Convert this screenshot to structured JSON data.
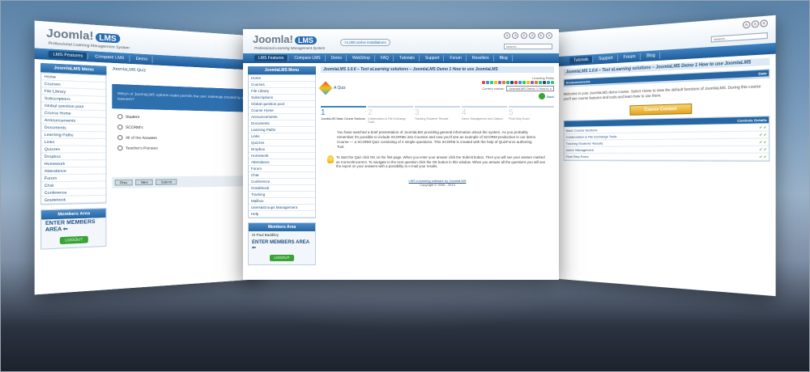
{
  "brand": {
    "logo_text": "Joomla!",
    "logo_badge": "LMS",
    "tagline": "Professional Learning Management System",
    "installs": ">1,000 active installations"
  },
  "header": {
    "tool_icons": [
      "A",
      "A",
      "A",
      "A",
      "A",
      "A"
    ],
    "search_placeholder": "search..."
  },
  "nav": [
    "LMS Features",
    "Compare LMS",
    "Demo",
    "WebShop",
    "FAQ",
    "Tutorials",
    "Support",
    "Forum",
    "Resellers",
    "Blog"
  ],
  "sidebar": {
    "title": "JoomlaLMS Menu",
    "items": [
      "Home",
      "Courses",
      "File Library",
      "Subscriptions",
      "Global question pool",
      "Course Home",
      "Announcements",
      "Documents",
      "Learning Paths",
      "Links",
      "Quizzes",
      "Dropbox",
      "Homework",
      "Attendance",
      "Forum",
      "Chat",
      "Conference",
      "Gradebook",
      "Tracking",
      "Mailbox",
      "Users&Groups Management",
      "Help"
    ]
  },
  "members": {
    "title": "Members Area",
    "greeting": "Hi Paul Baddiley",
    "enter": "ENTER MEMBERS AREA ⇐",
    "logout": "LOGOUT"
  },
  "main": {
    "title": "JoomlaLMS 1.0.6 – Test eLearning solutions – JoomlaLMS Demo 1 How to use JoomlaLMS",
    "quiz_label": "A Quiz",
    "learning_paths": "Learning Paths",
    "current_course_label": "Current course:",
    "current_course": "JoomlaLMS Demo 1 How to u",
    "back": "Back",
    "steps": [
      {
        "num": "1",
        "label": "JoomlaLMS Basic Course Sections"
      },
      {
        "num": "2",
        "label": "Collaboration & File Exchange Tools"
      },
      {
        "num": "3",
        "label": "Tracking Students' Results"
      },
      {
        "num": "4",
        "label": "Users' Management and Options"
      },
      {
        "num": "5",
        "label": "Final Step Exam"
      }
    ],
    "paragraph": "You have watched a brief presentation of JoomlaLMS providing general information about the system. As you probably remember it's possible to include SCORMs into Courses and now you'll see an example of SCORM production in our demo Course — a SCORM Quiz consisting of 4 simple questions. This SCORM is created with the help of QuizForce authoring Tool.",
    "hint": "To start the Quiz click OK on the first page. When you enter your answer click the Submit button. Then you will see your answer marked as Correct/Incorrect. To navigate to the next question click the OK button in this window. When you answer all the questions you will see the report on your answers with a possibility to e-mail your results.",
    "footer_link": "LMS e-learning software by JoomlaLMS",
    "footer_copy": "Copyright © 2006 - 2013"
  },
  "left_shot": {
    "quiz_title": "JoomlaLMS Quiz",
    "question": "Which of JoomlaLMS options make permits the user materials created by all learners?",
    "options": [
      "Student",
      "SCORM's",
      "All of the Answers",
      "Teacher's Pointers"
    ],
    "buttons": [
      "Prev",
      "Next",
      "Submit"
    ]
  },
  "right_shot": {
    "table_header": [
      "Announcements",
      "Date"
    ],
    "text": "Welcome to your JoomlaLMS demo course. Select Home to view the default functions of JoomlaLMS. During this course you'll see course features and tools and learn how to use them.",
    "button": "Course Content",
    "rows": [
      "Basic Course Sections",
      "Collaboration & File Exchange Tools",
      "Tracking Students' Results",
      "Users' Management",
      "Final Step Exam"
    ],
    "controls_label": "Controls",
    "details_label": "Details"
  },
  "colors": {
    "nav_blue": "#2566a3",
    "accent_green": "#3aa335",
    "accent_orange": "#e0a520"
  }
}
